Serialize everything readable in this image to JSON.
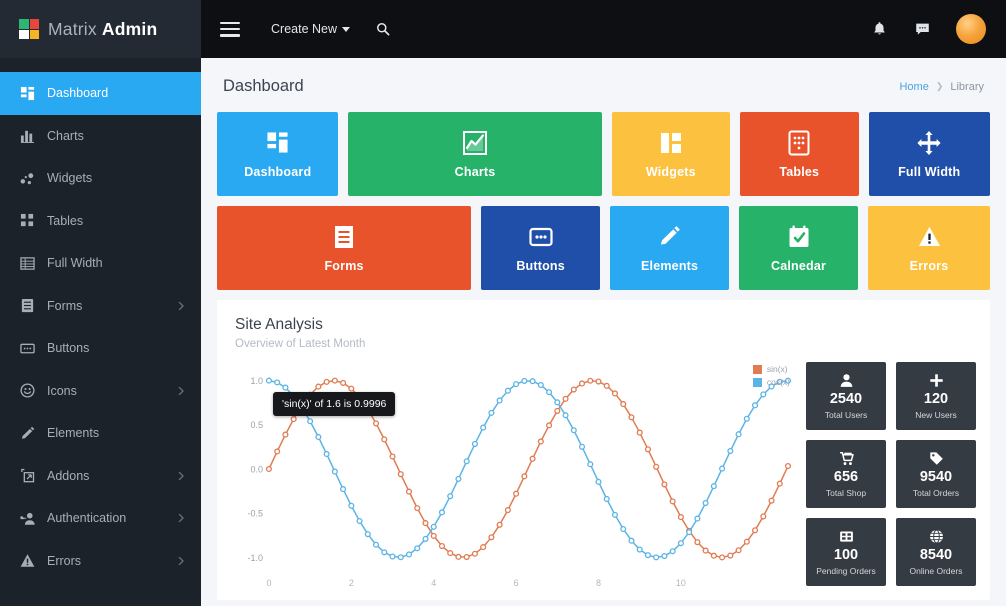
{
  "brand": {
    "name_light": "Matrix",
    "name_bold": "Admin",
    "logo_colors": [
      "#2bb673",
      "#e8453c",
      "#ffffff",
      "#f5b325"
    ]
  },
  "sidebar": {
    "items": [
      {
        "label": "Dashboard",
        "icon": "dashboard-grid-icon",
        "active": true,
        "chevron": false
      },
      {
        "label": "Charts",
        "icon": "bar-chart-icon",
        "active": false,
        "chevron": false
      },
      {
        "label": "Widgets",
        "icon": "widgets-icon",
        "active": false,
        "chevron": false
      },
      {
        "label": "Tables",
        "icon": "table-icon",
        "active": false,
        "chevron": false
      },
      {
        "label": "Full Width",
        "icon": "full-width-icon",
        "active": false,
        "chevron": false
      },
      {
        "label": "Forms",
        "icon": "forms-icon",
        "active": false,
        "chevron": true
      },
      {
        "label": "Buttons",
        "icon": "buttons-icon",
        "active": false,
        "chevron": false
      },
      {
        "label": "Icons",
        "icon": "smiley-icon",
        "active": false,
        "chevron": true
      },
      {
        "label": "Elements",
        "icon": "pencil-icon",
        "active": false,
        "chevron": false
      },
      {
        "label": "Addons",
        "icon": "addons-icon",
        "active": false,
        "chevron": true
      },
      {
        "label": "Authentication",
        "icon": "user-key-icon",
        "active": false,
        "chevron": true
      },
      {
        "label": "Errors",
        "icon": "warning-triangle-icon",
        "active": false,
        "chevron": true
      }
    ],
    "active_color": "#29a9f1"
  },
  "topbar": {
    "menu_toggle": "hamburger-icon",
    "create_new_label": "Create New",
    "search_icon": "search-icon",
    "notification_icon": "bell-icon",
    "message_icon": "comment-icon",
    "avatar": "user-avatar"
  },
  "page": {
    "title": "Dashboard",
    "breadcrumb": {
      "home": "Home",
      "separator": "❯",
      "current": "Library"
    }
  },
  "tiles": {
    "row1": [
      {
        "label": "Dashboard",
        "icon": "dashboard-grid-icon",
        "color": "#29a9f1",
        "flex": 120
      },
      {
        "label": "Charts",
        "icon": "line-chart-icon",
        "color": "#27b26a",
        "flex": 250
      },
      {
        "label": "Widgets",
        "icon": "widgets-panel-icon",
        "color": "#fcc13e",
        "flex": 117
      },
      {
        "label": "Tables",
        "icon": "table-grid-icon",
        "color": "#e8532b",
        "flex": 117
      },
      {
        "label": "Full Width",
        "icon": "arrows-move-icon",
        "color": "#1f4fa8",
        "flex": 120
      }
    ],
    "row2": [
      {
        "label": "Forms",
        "icon": "form-lines-icon",
        "color": "#e8532b",
        "flex": 250
      },
      {
        "label": "Buttons",
        "icon": "button-box-icon",
        "color": "#1f4fa8",
        "flex": 117
      },
      {
        "label": "Elements",
        "icon": "pencil-icon",
        "color": "#29a9f1",
        "flex": 117
      },
      {
        "label": "Calnedar",
        "icon": "calendar-check-icon",
        "color": "#27b26a",
        "flex": 117
      },
      {
        "label": "Errors",
        "icon": "warning-triangle-icon",
        "color": "#fcc13e",
        "flex": 120
      }
    ]
  },
  "panel": {
    "title": "Site Analysis",
    "subtitle": "Overview of Latest Month",
    "tooltip": "'sin(x)' of 1.6 is 0.9996"
  },
  "chart_data": {
    "type": "line",
    "title": "Site Analysis",
    "subtitle": "Overview of Latest Month",
    "xlabel": "",
    "ylabel": "",
    "xlim": [
      0,
      12.6
    ],
    "ylim": [
      -1.12,
      1.12
    ],
    "xticks": [
      0,
      2,
      4,
      6,
      8,
      10
    ],
    "yticks": [
      -1.0,
      -0.5,
      0.0,
      0.5,
      1.0
    ],
    "ytick_labels": [
      "-1.0",
      "-0.5",
      "0.0",
      "0.5",
      "1.0"
    ],
    "xtick_labels": [
      "0",
      "2",
      "4",
      "6",
      "8",
      "10"
    ],
    "grid": false,
    "markers": "open-circle",
    "legend_position": "top-right",
    "annotation": {
      "text": "'sin(x)' of 1.6 is 0.9996",
      "x": 1.6,
      "y": 0.9996
    },
    "series": [
      {
        "name": "sin(x)",
        "color": "#e07b52",
        "func": "sin",
        "phase": 0
      },
      {
        "name": "cos(x)",
        "color": "#5bb4e5",
        "func": "cos",
        "phase": 0
      }
    ],
    "x_step": 0.2
  },
  "stats": [
    {
      "value": "2540",
      "label": "Total Users",
      "icon": "user-icon"
    },
    {
      "value": "120",
      "label": "New Users",
      "icon": "plus-icon"
    },
    {
      "value": "656",
      "label": "Total Shop",
      "icon": "shopping-cart-icon"
    },
    {
      "value": "9540",
      "label": "Total Orders",
      "icon": "tag-icon"
    },
    {
      "value": "100",
      "label": "Pending Orders",
      "icon": "grid-squares-icon"
    },
    {
      "value": "8540",
      "label": "Online Orders",
      "icon": "globe-icon"
    }
  ]
}
